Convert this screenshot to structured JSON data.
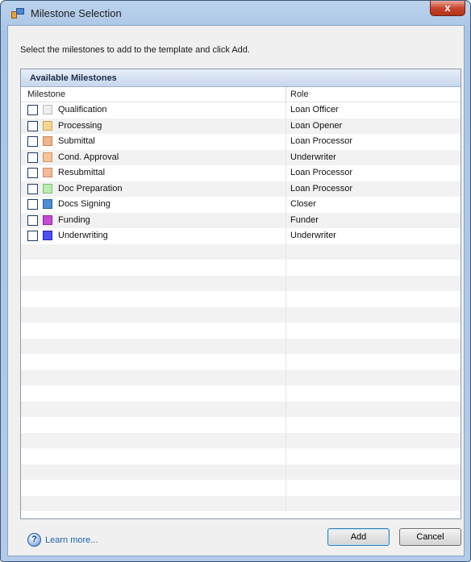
{
  "window": {
    "title": "Milestone Selection",
    "close_label": "x"
  },
  "instruction": "Select the milestones to add to the template and click Add.",
  "panel": {
    "title": "Available Milestones",
    "columns": {
      "milestone": "Milestone",
      "role": "Role"
    },
    "rows": [
      {
        "name": "Qualification",
        "role": "Loan Officer",
        "checked": false,
        "color": "#eeeeee",
        "border": "#bdbdbd"
      },
      {
        "name": "Processing",
        "role": "Loan Opener",
        "checked": false,
        "color": "#f3d68f",
        "border": "#c7a85a"
      },
      {
        "name": "Submittal",
        "role": "Loan Processor",
        "checked": false,
        "color": "#f0b58a",
        "border": "#c48759"
      },
      {
        "name": "Cond. Approval",
        "role": "Underwriter",
        "checked": false,
        "color": "#f4c39a",
        "border": "#c99468"
      },
      {
        "name": "Resubmittal",
        "role": "Loan Processor",
        "checked": false,
        "color": "#f3b99b",
        "border": "#c88a6c"
      },
      {
        "name": "Doc Preparation",
        "role": "Loan Processor",
        "checked": false,
        "color": "#b8ecb0",
        "border": "#82bb78"
      },
      {
        "name": "Docs Signing",
        "role": "Closer",
        "checked": false,
        "color": "#4d8fd6",
        "border": "#2a5d98"
      },
      {
        "name": "Funding",
        "role": "Funder",
        "checked": false,
        "color": "#c64ad6",
        "border": "#8b2898"
      },
      {
        "name": "Underwriting",
        "role": "Underwriter",
        "checked": false,
        "color": "#4f4ff0",
        "border": "#2626a8"
      }
    ],
    "empty_rows": 17
  },
  "footer": {
    "help_glyph": "?",
    "learn_more": "Learn more...",
    "add_label": "Add",
    "cancel_label": "Cancel"
  }
}
